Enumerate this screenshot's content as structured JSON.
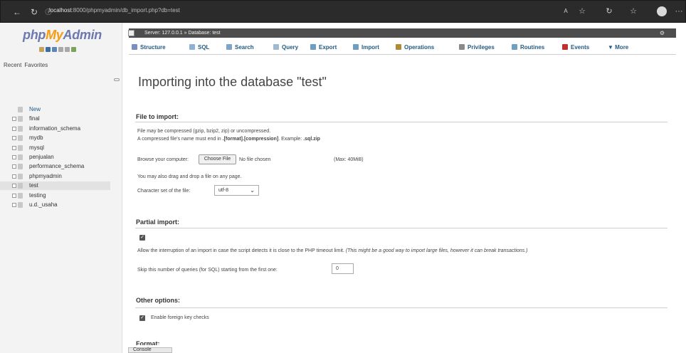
{
  "browser": {
    "url_host": "localhost",
    "url_path": ":8000/phpmyadmin/db_import.php?db=test",
    "more_label": "···"
  },
  "sidebar": {
    "logo_php": "php",
    "logo_my": "My",
    "logo_admin": "Admin",
    "recent_label": "Recent",
    "favorites_label": "Favorites",
    "tree": [
      {
        "label": "New"
      },
      {
        "label": "final"
      },
      {
        "label": "information_schema"
      },
      {
        "label": "mydb"
      },
      {
        "label": "mysql"
      },
      {
        "label": "penjualan"
      },
      {
        "label": "performance_schema"
      },
      {
        "label": "phpmyadmin"
      },
      {
        "label": "test"
      },
      {
        "label": "testing"
      },
      {
        "label": "u.d._usaha"
      }
    ]
  },
  "serverbar": {
    "crumb": "Server: 127.0.0.1 » Database: test"
  },
  "tabs": [
    {
      "label": "Structure",
      "icon": "structure-icon",
      "color": "#7a8fbf"
    },
    {
      "label": "SQL",
      "icon": "sql-icon",
      "color": "#8fb0d6"
    },
    {
      "label": "Search",
      "icon": "search-icon",
      "color": "#7da5c9"
    },
    {
      "label": "Query",
      "icon": "query-icon",
      "color": "#9fb9cf"
    },
    {
      "label": "Export",
      "icon": "export-icon",
      "color": "#6f9fbf"
    },
    {
      "label": "Import",
      "icon": "import-icon",
      "color": "#6f9fbf"
    },
    {
      "label": "Operations",
      "icon": "wrench-icon",
      "color": "#b08a3a"
    },
    {
      "label": "Privileges",
      "icon": "privileges-icon",
      "color": "#8a8a8a"
    },
    {
      "label": "Routines",
      "icon": "routines-icon",
      "color": "#6fa0c0"
    },
    {
      "label": "Events",
      "icon": "clock-icon",
      "color": "#c03030"
    },
    {
      "label": "▼ More",
      "icon": "",
      "color": "#777777"
    }
  ],
  "main": {
    "title": "Importing into the database \"test\"",
    "file_section_title": "File to import:",
    "compress_line1": "File may be compressed (gzip, bzip2, zip) or uncompressed.",
    "compress_line2_prefix": "A compressed file's name must end in ",
    "compress_line2_format": ".[format].[compression]",
    "compress_line2_mid": ". Example: ",
    "compress_line2_example": ".sql.zip",
    "browse_label": "Browse your computer:",
    "choose_file_label": "Choose File",
    "no_file_label": "No file chosen",
    "max_label": "(Max: 40MiB)",
    "drag_label": "You may also drag and drop a file on any page.",
    "charset_label": "Character set of the file:",
    "charset_value": "utf-8",
    "partial_section_title": "Partial import:",
    "allow_interrupt_text": "Allow the interruption of an import in case the script detects it is close to the PHP timeout limit.",
    "allow_interrupt_note": "(This might be a good way to import large files, however it can break transactions.)",
    "skip_label": "Skip this number of queries (for SQL) starting from the first one:",
    "skip_value": "0",
    "other_section_title": "Other options:",
    "fk_label": "Enable foreign key checks",
    "format_section_title": "Format:"
  },
  "console_label": "Console"
}
